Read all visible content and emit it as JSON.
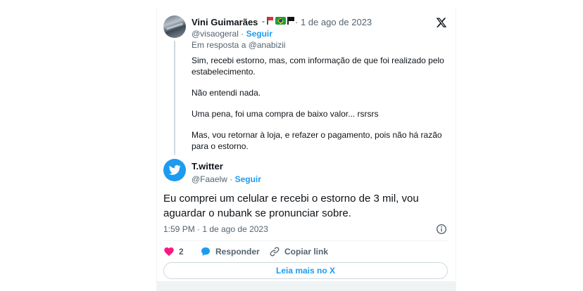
{
  "parent_tweet": {
    "author_name": "Vini Guimarães",
    "badge_separator": "-",
    "date": "· 1 de ago de 2023",
    "handle": "@visaogeral",
    "dot": "·",
    "follow_label": "Seguir",
    "reply_to": "Em resposta a @anabizii",
    "paragraphs": [
      "Sim, recebi estorno, mas, com informação de que foi realizado pelo estabelecimento.",
      "Não entendi nada.",
      "Uma pena, foi uma compra de baixo valor... rsrsrs",
      "Mas, vou retornar à loja, e refazer o pagamento, pois não há razão para o estorno."
    ]
  },
  "main_tweet": {
    "author_name": "T.witter",
    "handle": "@Faaelw",
    "dot": "·",
    "follow_label": "Seguir",
    "text": "Eu comprei um celular e recebi o estorno de 3 mil, vou aguardar o nubank se pronunciar sobre.",
    "timestamp": "1:59 PM · 1 de ago de 2023"
  },
  "actions": {
    "like_count": "2",
    "reply_label": "Responder",
    "copy_link_label": "Copiar link"
  },
  "read_more_label": "Leia mais no X",
  "icons": {
    "brand": "x-logo-icon",
    "info": "info-icon",
    "like": "heart-icon",
    "reply": "speech-bubble-icon",
    "link": "link-icon"
  },
  "colors": {
    "accent": "#1d9bf0",
    "like": "#f91880",
    "text": "#0f1419",
    "muted": "#536471"
  }
}
